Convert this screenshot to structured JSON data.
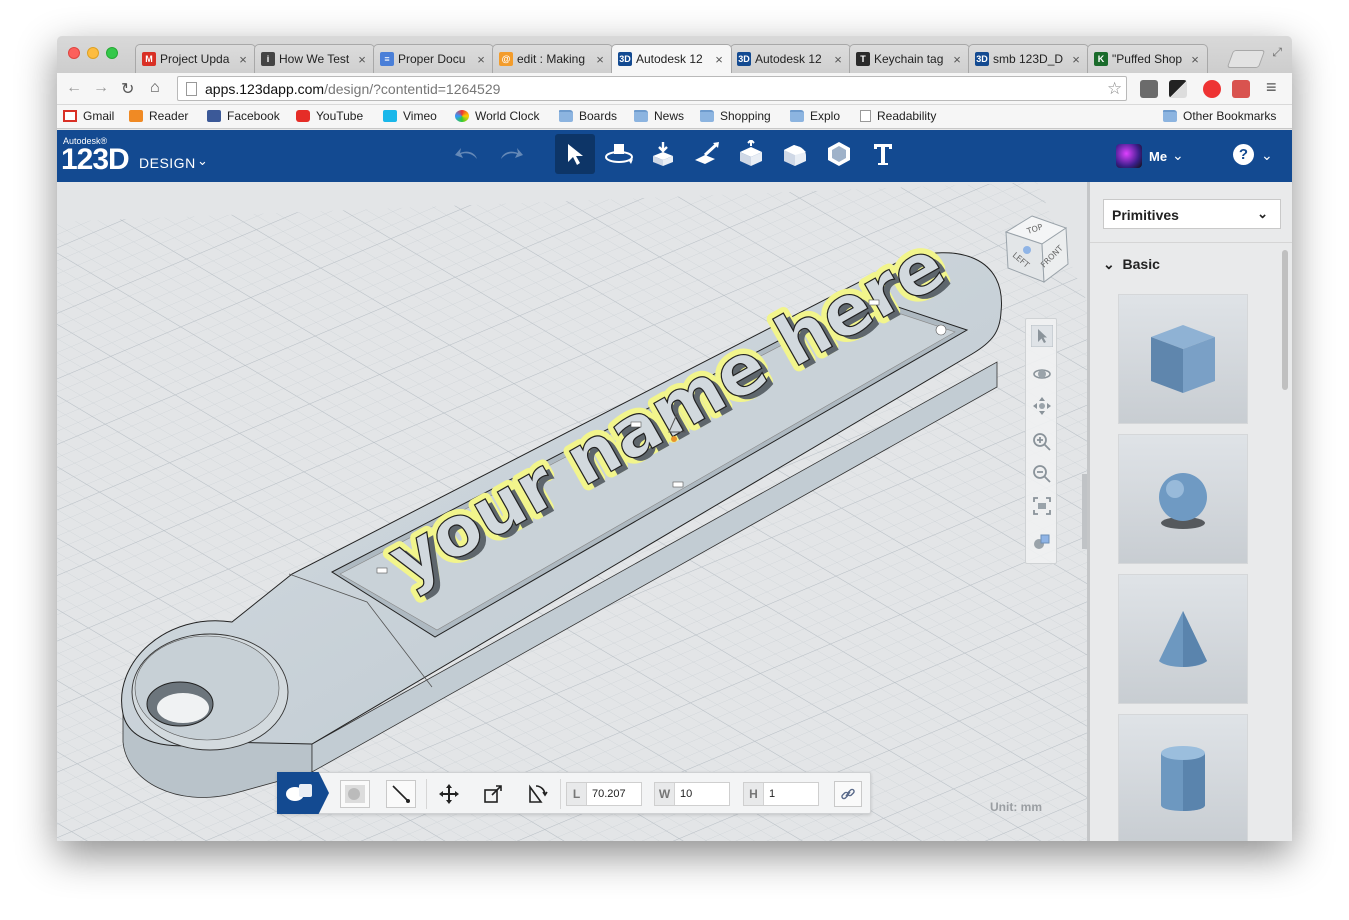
{
  "tabs": [
    {
      "title": "Project Upda",
      "icon": "gmail-icon",
      "color": "#d93025",
      "glyph": "M",
      "active": false
    },
    {
      "title": "How We Test",
      "icon": "instructables-icon",
      "color": "#444444",
      "glyph": "i",
      "active": false
    },
    {
      "title": "Proper Docu",
      "icon": "docs-icon",
      "color": "#4a7fd8",
      "glyph": "≡",
      "active": false
    },
    {
      "title": "edit : Making",
      "icon": "instructables-edit-icon",
      "color": "#f39c2b",
      "glyph": "@",
      "active": false
    },
    {
      "title": "Autodesk 12",
      "icon": "autodesk-123d-icon",
      "color": "#134a91",
      "glyph": "3D",
      "active": true
    },
    {
      "title": "Autodesk 12",
      "icon": "autodesk-123d-icon",
      "color": "#134a91",
      "glyph": "3D",
      "active": false
    },
    {
      "title": "Keychain tag",
      "icon": "thingiverse-icon",
      "color": "#2a2a2a",
      "glyph": "T",
      "active": false
    },
    {
      "title": "smb 123D_D",
      "icon": "autodesk-123d-icon",
      "color": "#134a91",
      "glyph": "3D",
      "active": false
    },
    {
      "title": "\"Puffed Shop",
      "icon": "k-icon",
      "color": "#1a6b2b",
      "glyph": "K",
      "active": false
    }
  ],
  "tab_close": "×",
  "address": {
    "host": "apps.123dapp.com",
    "path": "/design/?contentid=1264529"
  },
  "bookmarks": [
    {
      "label": "Gmail",
      "icon": "gmail-icon"
    },
    {
      "label": "Reader",
      "icon": "rss-icon"
    },
    {
      "label": "Facebook",
      "icon": "facebook-icon"
    },
    {
      "label": "YouTube",
      "icon": "youtube-icon"
    },
    {
      "label": "Vimeo",
      "icon": "vimeo-icon"
    },
    {
      "label": "World Clock",
      "icon": "clock-icon"
    },
    {
      "label": "Boards",
      "icon": "folder-icon"
    },
    {
      "label": "News",
      "icon": "folder-icon"
    },
    {
      "label": "Shopping",
      "icon": "folder-icon"
    },
    {
      "label": "Explo",
      "icon": "folder-icon"
    },
    {
      "label": "Readability",
      "icon": "page-icon"
    }
  ],
  "other_bookmarks": "Other Bookmarks",
  "app": {
    "brand_small": "Autodesk®",
    "brand_big": "123D",
    "brand_design": "DESIGN",
    "user": "Me",
    "help": "?",
    "chevron": "⌄"
  },
  "panel": {
    "category": "Primitives",
    "section": "Basic",
    "items": [
      "box",
      "sphere",
      "cone",
      "cylinder"
    ]
  },
  "navcube": {
    "top": "TOP",
    "left": "LEFT",
    "front": "FRONT"
  },
  "model": {
    "text": "your name here"
  },
  "dimensions": {
    "length_label": "L",
    "length_value": "70.207",
    "width_label": "W",
    "width_value": "10",
    "height_label": "H",
    "height_value": "1"
  },
  "units": "Unit:  mm",
  "colors": {
    "brand": "#134a91",
    "highlight": "#f2f58c",
    "model": "#c9d2d8"
  }
}
